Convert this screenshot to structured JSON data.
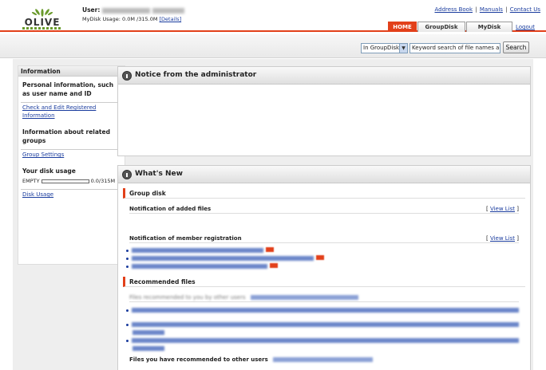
{
  "header": {
    "logo_text": "OLIVE",
    "user_label": "User:",
    "mydisk_usage_label": "MyDisk Usage:",
    "mydisk_usage_value": "0.0M /315.0M",
    "details_link": "[Details]",
    "top_links": [
      "Address Book",
      "Manuals",
      "Contact Us"
    ],
    "link_separator": "|",
    "tabs": [
      {
        "label": "HOME",
        "active": true
      },
      {
        "label": "GroupDisk",
        "active": false
      },
      {
        "label": "MyDisk",
        "active": false
      }
    ],
    "logout_label": "Logout"
  },
  "search": {
    "scope_selected": "In GroupDisk",
    "input_value": "Keyword search of file names and",
    "button_label": "Search"
  },
  "sidebar": {
    "title": "Information",
    "sections": [
      {
        "heading": "Personal information, such as user name and ID",
        "link": "Check and Edit Registered Information"
      },
      {
        "heading": "Information about related groups",
        "link": "Group Settings"
      },
      {
        "heading": "Your disk usage",
        "link": "Disk Usage"
      }
    ],
    "disk_empty_label": "EMPTY",
    "disk_usage_value": "0.0/315M"
  },
  "notice": {
    "title": "Notice from the administrator"
  },
  "whats_new": {
    "title": "What's New",
    "group_disk": {
      "label": "Group disk",
      "added_files_heading": "Notification of added files",
      "member_registration_heading": "Notification of member registration",
      "view_list_label": "View List",
      "bracket_open": "[",
      "bracket_close": "]"
    },
    "recommended": {
      "label": "Recommended files",
      "by_others_heading": "Files recommended to you by other users",
      "by_you_heading": "Files you have recommended to other users"
    }
  },
  "colors": {
    "accent": "#e2401a",
    "link": "#1a3c9e",
    "panel_bg": "#eeeeee"
  }
}
